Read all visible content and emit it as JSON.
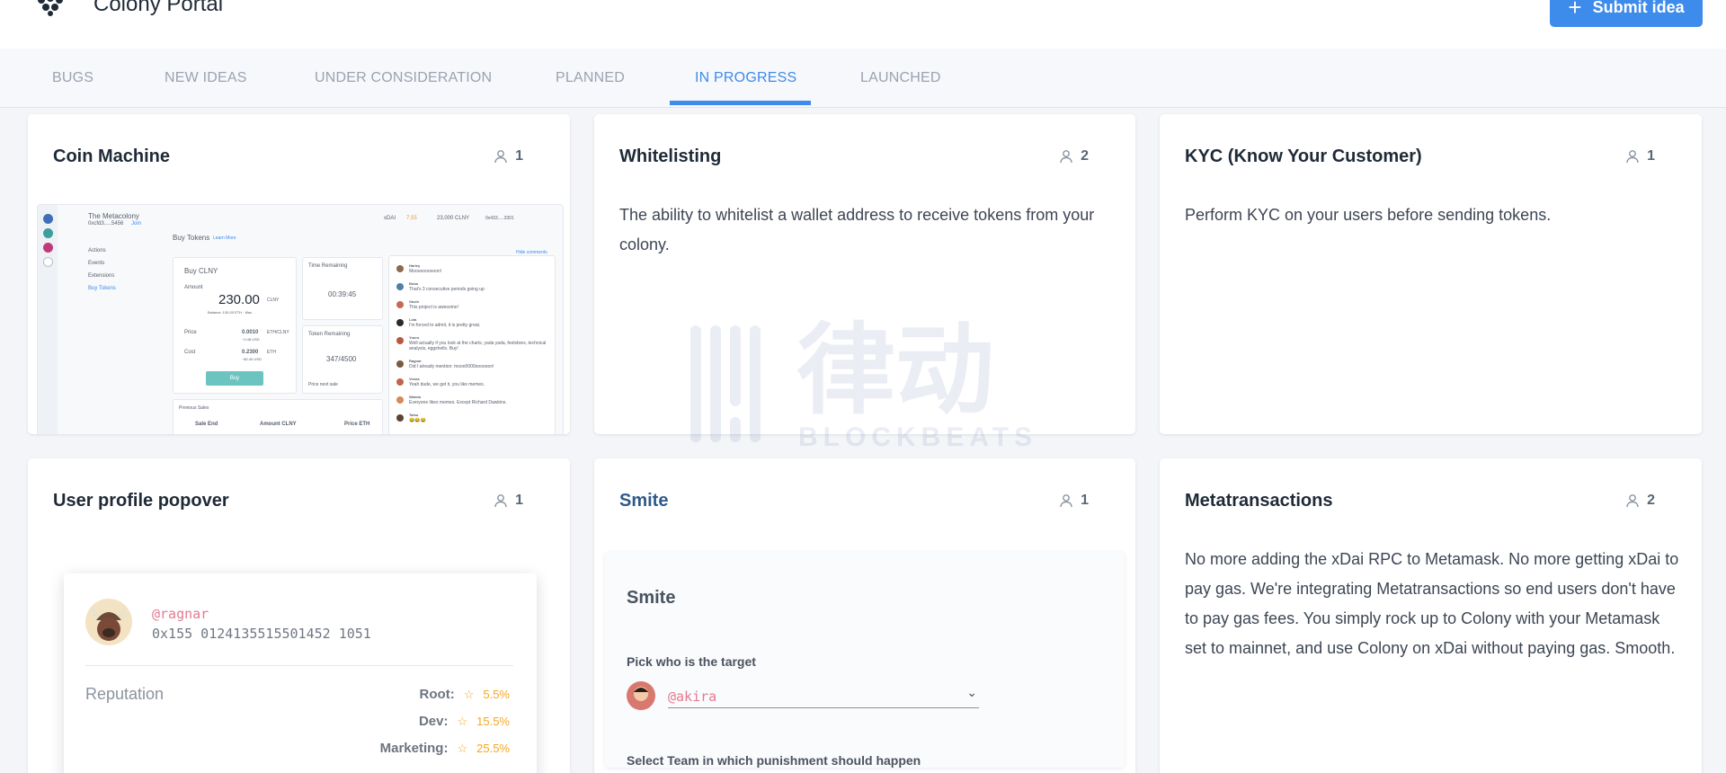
{
  "header": {
    "app_title": "Colony Portal",
    "submit_label": "Submit idea"
  },
  "tabs": [
    {
      "label": "BUGS",
      "active": false
    },
    {
      "label": "NEW IDEAS",
      "active": false
    },
    {
      "label": "UNDER CONSIDERATION",
      "active": false
    },
    {
      "label": "PLANNED",
      "active": false
    },
    {
      "label": "IN PROGRESS",
      "active": true
    },
    {
      "label": "LAUNCHED",
      "active": false
    }
  ],
  "cards": [
    {
      "title": "Coin Machine",
      "votes": "1"
    },
    {
      "title": "Whitelisting",
      "votes": "2",
      "description": "The ability to whitelist a wallet address to receive tokens from your colony."
    },
    {
      "title": "KYC (Know Your Customer)",
      "votes": "1",
      "description": "Perform KYC on your users before sending tokens."
    },
    {
      "title": "User profile popover",
      "votes": "1"
    },
    {
      "title": "Smite",
      "votes": "1"
    },
    {
      "title": "Metatransactions",
      "votes": "2",
      "description": "No more adding the xDai RPC to Metamask. No more getting xDai to pay gas. We're integrating Metatransactions so end users don't have to pay gas fees. You simply rock up to Colony with your Metamask set to mainnet, and use Colony on xDai without paying gas. Smooth."
    }
  ],
  "coin_preview": {
    "colony_name": "The Metacolony",
    "colony_addr": "0xcfd3.....5456",
    "join": "Join",
    "nav": [
      "Actions",
      "Events",
      "Extensions",
      "Buy Tokens"
    ],
    "buy_tokens": "Buy Tokens",
    "learn_more": "Learn More",
    "network": "xDAI",
    "balance": "23,000 CLNY",
    "address": "0x433.....3301",
    "hide_comments": "Hide comments",
    "buy_clny": "Buy CLNY",
    "amount_label": "Amount",
    "amount_value": "230.00",
    "amount_unit": "CLNY",
    "balance_line": "Balance: 130.00 ETH · Max",
    "price_label": "Price",
    "price_value": "0.0010",
    "price_unit": "ETH/CLNY",
    "price_usd": "~0.48 USD",
    "cost_label": "Cost",
    "cost_value": "0.2300",
    "cost_unit": "ETH",
    "cost_usd": "~$2.49 USD",
    "buy_button": "Buy",
    "time_remaining": "Time Remaining",
    "time_value": "00:39:45",
    "tokens_remaining": "Token Remaining",
    "tokens_value": "347/4500",
    "price_next": "Price next sale",
    "previous_sales": "Previous Sales",
    "sale_end": "Sale End",
    "amount_col": "Amount CLNY",
    "price_col": "Price ETH",
    "comments": [
      {
        "name": "Harley",
        "text": "Moooooooooon!"
      },
      {
        "name": "Bobo",
        "text": "That's 3 consecutive periods going up"
      },
      {
        "name": "Gavin",
        "text": "This project is awesome!"
      },
      {
        "name": "Lola",
        "text": "I'm forced to admit, it is pretty great."
      },
      {
        "name": "Yuuro",
        "text": "Well actually if you look at the charts, yada yada, feelsbres, technical analysis, eggshells. Buy!"
      },
      {
        "name": "Ragnar",
        "text": "Did I already mention: mooo0000oooooon!"
      },
      {
        "name": "Vesna",
        "text": "Yeah dude, we get it, you like memes."
      },
      {
        "name": "Wanda",
        "text": "Everyone likes memes. Except Richard Dawkins."
      },
      {
        "name": "Tatsu",
        "text": "😂😂😂"
      }
    ]
  },
  "profile_preview": {
    "handle": "@ragnar",
    "address": "0x155 0124135515501452 1051",
    "reputation_label": "Reputation",
    "rows": [
      {
        "key": "Root:",
        "value": "5.5%"
      },
      {
        "key": "Dev:",
        "value": "15.5%"
      },
      {
        "key": "Marketing:",
        "value": "25.5%"
      }
    ]
  },
  "smite_preview": {
    "title": "Smite",
    "target_label": "Pick who is the target",
    "target_value": "@akira",
    "team_label": "Select Team in which punishment should happen"
  },
  "watermark": {
    "chinese": "律动",
    "latin": "BLOCKBEATS"
  },
  "colors": {
    "accent": "#3d8bea",
    "background": "#f3f5f8",
    "card": "#ffffff",
    "star": "#f5a623",
    "handle": "#e57a8f"
  }
}
